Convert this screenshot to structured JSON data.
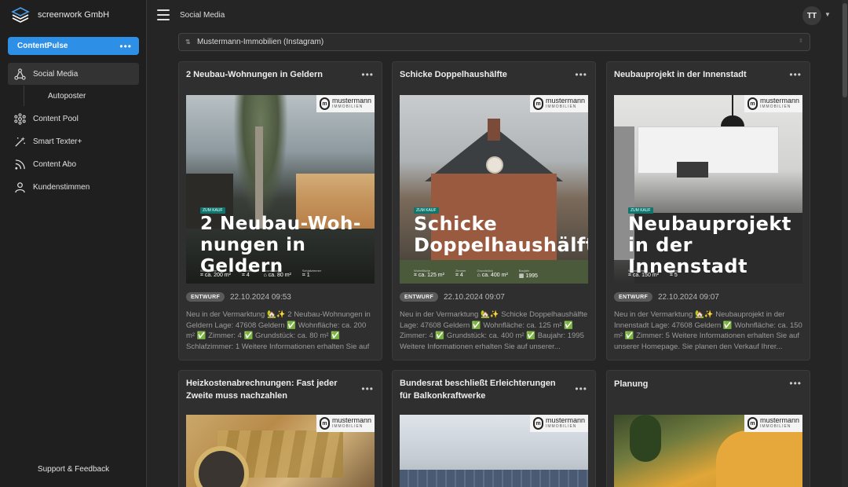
{
  "brand": {
    "name": "screenwork GmbH",
    "icon": "stack-logo-icon"
  },
  "workspace": {
    "label": "ContentPulse"
  },
  "nav": {
    "items": [
      {
        "label": "Social Media",
        "icon": "network-icon"
      },
      {
        "label": "Content Pool",
        "icon": "pool-icon"
      },
      {
        "label": "Smart Texter+",
        "icon": "magic-wand-icon"
      },
      {
        "label": "Content Abo",
        "icon": "rss-icon"
      },
      {
        "label": "Kundenstimmen",
        "icon": "person-icon"
      }
    ],
    "sub_items": [
      {
        "label": "Autoposter"
      }
    ]
  },
  "support": {
    "label": "Support & Feedback"
  },
  "header": {
    "title": "Social Media",
    "avatar_initials": "TT"
  },
  "account_select": {
    "value": "Mustermann-Immobilien (Instagram)"
  },
  "logo_badge": {
    "line1": "mustermann",
    "line2": "IMMOBILIEN"
  },
  "cards": [
    {
      "title": "2 Neubau-Wohnungen in Geldern",
      "status": "ENTWURF",
      "timestamp": "22.10.2024 09:53",
      "image_tag": "ZUM KAUF",
      "image_heading_1": "2 Neubau-Woh-",
      "image_heading_2": "nungen in Geldern",
      "facts": [
        {
          "label": "Wohnfläche",
          "value": "⌗ ca. 200 m²"
        },
        {
          "label": "Zimmer",
          "value": "⌗ 4"
        },
        {
          "label": "Grundstück",
          "value": "⌂ ca. 80 m²"
        },
        {
          "label": "Schlafzimmer",
          "value": "⌗ 1"
        }
      ],
      "description": "Neu in der Vermarktung 🏡✨ 2 Neubau-Wohnungen in Geldern Lage: 47608 Geldern ✅ Wohnfläche: ca. 200 m² ✅ Zimmer: 4 ✅ Grundstück: ca. 80 m² ✅ Schlafzimmer: 1 Weitere Informationen erhalten Sie auf unserer..."
    },
    {
      "title": "Schicke Doppelhaushälfte",
      "status": "ENTWURF",
      "timestamp": "22.10.2024 09:07",
      "image_tag": "ZUM KAUF",
      "image_heading_1": "Schicke",
      "image_heading_2": "Doppelhaushälfte",
      "facts": [
        {
          "label": "Wohnfläche",
          "value": "⌗ ca. 125 m²"
        },
        {
          "label": "Zimmer",
          "value": "⌗ 4"
        },
        {
          "label": "Grundstück",
          "value": "⌂ ca. 400 m²"
        },
        {
          "label": "Baujahr",
          "value": "▦ 1995"
        }
      ],
      "description": "Neu in der Vermarktung 🏡✨ Schicke Doppelhaushälfte Lage: 47608 Geldern ✅ Wohnfläche: ca. 125 m² ✅ Zimmer: 4 ✅ Grundstück: ca. 400 m² ✅ Baujahr: 1995 Weitere Informationen erhalten Sie auf unserer..."
    },
    {
      "title": "Neubauprojekt in der Innenstadt",
      "status": "ENTWURF",
      "timestamp": "22.10.2024 09:07",
      "image_tag": "ZUM KAUF",
      "image_heading_1": "Neubauprojekt",
      "image_heading_2": "in der Innenstadt",
      "facts": [
        {
          "label": "Wohnfläche",
          "value": "⌗ ca. 150 m²"
        },
        {
          "label": "Zimmer",
          "value": "⌗ 5"
        }
      ],
      "description": "Neu in der Vermarktung 🏡✨ Neubauprojekt in der Innenstadt Lage: 47608 Geldern ✅ Wohnfläche: ca. 150 m² ✅ Zimmer: 5 Weitere Informationen erhalten Sie auf unserer Homepage. Sie planen den Verkauf Ihrer..."
    },
    {
      "title": "Heizkostenabrechnungen: Fast jeder Zweite muss nachzahlen"
    },
    {
      "title": "Bundesrat beschließt Erleichterungen für Balkonkraftwerke"
    },
    {
      "title": "Planung"
    }
  ]
}
